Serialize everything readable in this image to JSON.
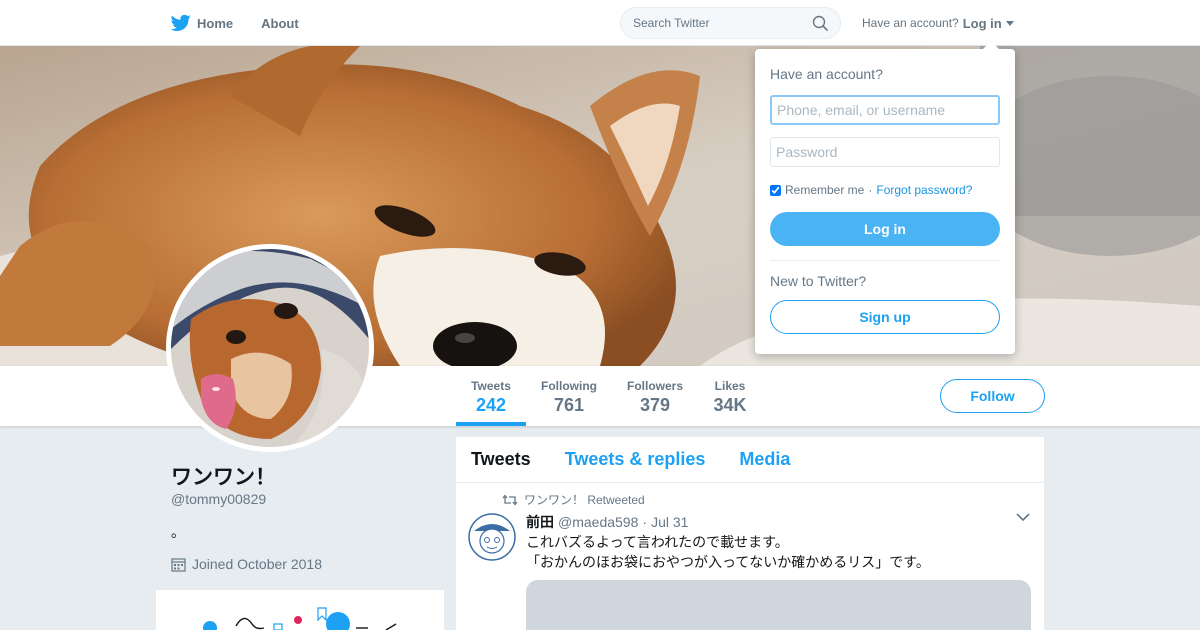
{
  "nav": {
    "home_label": "Home",
    "about_label": "About",
    "search_placeholder": "Search Twitter",
    "have_account": "Have an account?",
    "login_label": "Log in"
  },
  "profile": {
    "name": "ワンワン！",
    "handle": "@tommy00829",
    "bio": "。",
    "joined": "Joined October 2018",
    "follow_label": "Follow",
    "stats": [
      {
        "label": "Tweets",
        "value": "242",
        "active": true
      },
      {
        "label": "Following",
        "value": "761"
      },
      {
        "label": "Followers",
        "value": "379"
      },
      {
        "label": "Likes",
        "value": "34K"
      }
    ]
  },
  "timeline": {
    "tabs": [
      "Tweets",
      "Tweets & replies",
      "Media"
    ],
    "tweet": {
      "retweet_label": "ワンワン！ Retweeted",
      "author_name": "前田",
      "author_handle": "@maeda598",
      "time": "Jul 31",
      "text_line1": "これバズるよって言われたので載せます。",
      "text_line2": "「おかんのほお袋におやつが入ってないか確かめるリス」です。"
    }
  },
  "login_dropdown": {
    "title": "Have an account?",
    "username_placeholder": "Phone, email, or username",
    "password_placeholder": "Password",
    "remember_label": "Remember me",
    "separator": "·",
    "forgot_label": "Forgot password?",
    "login_button": "Log in",
    "new_label": "New to Twitter?",
    "signup_button": "Sign up"
  },
  "colors": {
    "accent": "#1da1f2",
    "login_button": "#4ab3f4",
    "muted_text": "#657786",
    "page_bg": "#e6ecf0"
  },
  "icons": [
    "twitter-bird-icon",
    "search-icon",
    "caret-down-icon",
    "calendar-icon",
    "retweet-icon",
    "chevron-down-icon"
  ]
}
